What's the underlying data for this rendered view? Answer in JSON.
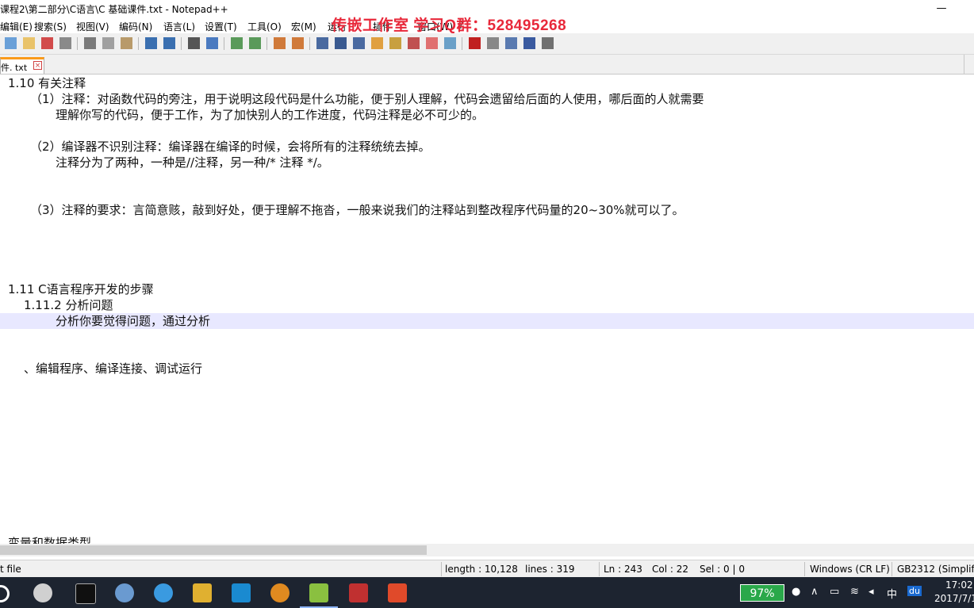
{
  "window": {
    "title": "课程2\\第二部分\\C语言\\C 基础课件.txt - Notepad++",
    "minimize_glyph": "—",
    "watermark": "传嵌工作室   学习Q群：528495268"
  },
  "menu": [
    "编辑(E)",
    "搜索(S)",
    "视图(V)",
    "编码(N)",
    "语言(L)",
    "设置(T)",
    "工具(O)",
    "宏(M)",
    "运行",
    "插件",
    "窗口(W)",
    "?"
  ],
  "tab": {
    "label": "件. txt",
    "close_glyph": "×"
  },
  "editor": {
    "lines": [
      {
        "indent": 10,
        "text": "1.10 有关注释"
      },
      {
        "indent": 38,
        "text": "（1）注释：对函数代码的旁注，用于说明这段代码是什么功能，便于别人理解，代码会遗留给后面的人使用，哪后面的人就需要"
      },
      {
        "indent": 70,
        "text": "理解你写的代码，便于工作，为了加快别人的工作进度，代码注释是必不可少的。"
      },
      {
        "indent": 0,
        "text": ""
      },
      {
        "indent": 38,
        "text": "（2）编译器不识别注释：编译器在编译的时候，会将所有的注释统统去掉。"
      },
      {
        "indent": 70,
        "text": "注释分为了两种，一种是//注释，另一种/* 注释 */。"
      },
      {
        "indent": 0,
        "text": ""
      },
      {
        "indent": 0,
        "text": ""
      },
      {
        "indent": 38,
        "text": "（3）注释的要求：言简意赅，敲到好处，便于理解不拖沓，一般来说我们的注释站到整改程序代码量的20~30%就可以了。"
      },
      {
        "indent": 0,
        "text": ""
      },
      {
        "indent": 0,
        "text": ""
      },
      {
        "indent": 0,
        "text": ""
      },
      {
        "indent": 0,
        "text": ""
      },
      {
        "indent": 10,
        "text": "1.11 C语言程序开发的步骤"
      },
      {
        "indent": 30,
        "text": "1.11.2 分析问题"
      },
      {
        "indent": 70,
        "text": "分析你要觉得问题，通过分析",
        "current": true
      },
      {
        "indent": 0,
        "text": ""
      },
      {
        "indent": 0,
        "text": ""
      },
      {
        "indent": 30,
        "text": "、编辑程序、编译连接、调试运行"
      },
      {
        "indent": 0,
        "text": ""
      },
      {
        "indent": 0,
        "text": ""
      },
      {
        "indent": 0,
        "text": ""
      },
      {
        "indent": 0,
        "text": ""
      },
      {
        "indent": 0,
        "text": ""
      },
      {
        "indent": 0,
        "text": ""
      },
      {
        "indent": 0,
        "text": ""
      },
      {
        "indent": 0,
        "text": ""
      },
      {
        "indent": 0,
        "text": ""
      },
      {
        "indent": 0,
        "text": ""
      },
      {
        "indent": 10,
        "text": "变量和数据类型"
      }
    ]
  },
  "status": {
    "file_type": "t file",
    "length": "length : 10,128",
    "lines": "lines : 319",
    "ln": "Ln : 243",
    "col": "Col : 22",
    "sel": "Sel : 0 | 0",
    "eol": "Windows (CR LF)",
    "encoding": "GB2312 (Simplifie"
  },
  "taskbar": {
    "battery": "97%",
    "ime": "中",
    "du": "du",
    "time": "17:02",
    "date": "2017/7/1"
  },
  "colors": {
    "watermark": "#e8283a",
    "tab_accent": "#fa9a1a",
    "current_line": "#e8e8ff",
    "taskbar": "#1d2430",
    "battery": "#2aa84a"
  }
}
